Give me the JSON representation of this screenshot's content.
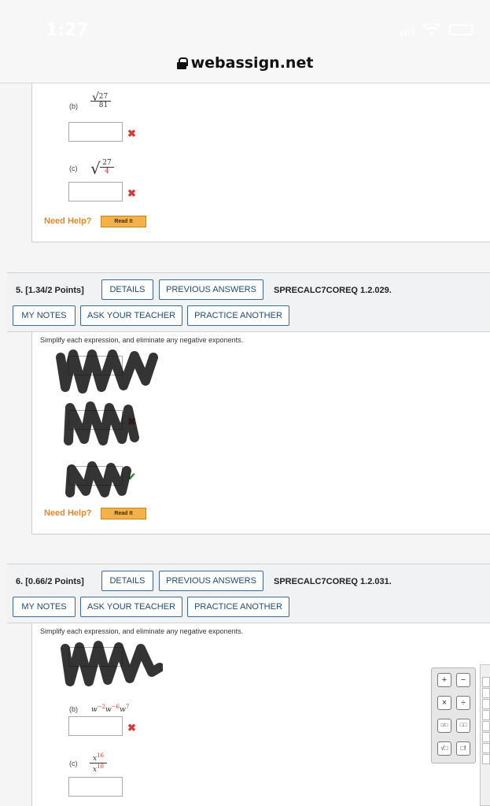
{
  "status_bar": {
    "time": "1:27"
  },
  "browser": {
    "url": "webassign.net"
  },
  "q4": {
    "part_b_label": "(b)",
    "part_b_num": "27",
    "part_b_den": "81",
    "part_c_label": "(c)",
    "part_c_num": "27",
    "part_c_den": "4",
    "need_help": "Need Help?",
    "read_it": "Read It"
  },
  "q5": {
    "title": "5.  [1.34/2 Points]",
    "details": "DETAILS",
    "previous_answers": "PREVIOUS ANSWERS",
    "code": "SPRECALC7COREQ 1.2.029.",
    "my_notes": "MY NOTES",
    "ask_teacher": "ASK YOUR TEACHER",
    "practice_another": "PRACTICE ANOTHER",
    "prompt": "Simplify each expression, and eliminate any negative exponents.",
    "need_help": "Need Help?",
    "read_it": "Read It"
  },
  "q6": {
    "title": "6.  [0.66/2 Points]",
    "details": "DETAILS",
    "previous_answers": "PREVIOUS ANSWERS",
    "code": "SPRECALC7COREQ 1.2.031.",
    "my_notes": "MY NOTES",
    "ask_teacher": "ASK YOUR TEACHER",
    "practice_another": "PRACTICE ANOTHER",
    "prompt": "Simplify each expression, and eliminate any negative exponents.",
    "part_b_label": "(b)",
    "part_b_base1": "w",
    "part_b_exp1": "−2",
    "part_b_base2": "w",
    "part_b_exp2": "−6",
    "part_b_base3": "w",
    "part_b_exp3": "7",
    "part_c_label": "(c)",
    "part_c_num_base": "x",
    "part_c_num_exp": "16",
    "part_c_den_base": "x",
    "part_c_den_exp": "10"
  },
  "palette": {
    "keys": [
      "+",
      "−",
      "×",
      "÷",
      "□/□",
      "□□",
      "√□",
      "□!"
    ]
  },
  "colors": {
    "accent": "#1f4a75",
    "error": "#d43b3b",
    "help": "#e0892a",
    "ok": "#2d8a2d"
  }
}
